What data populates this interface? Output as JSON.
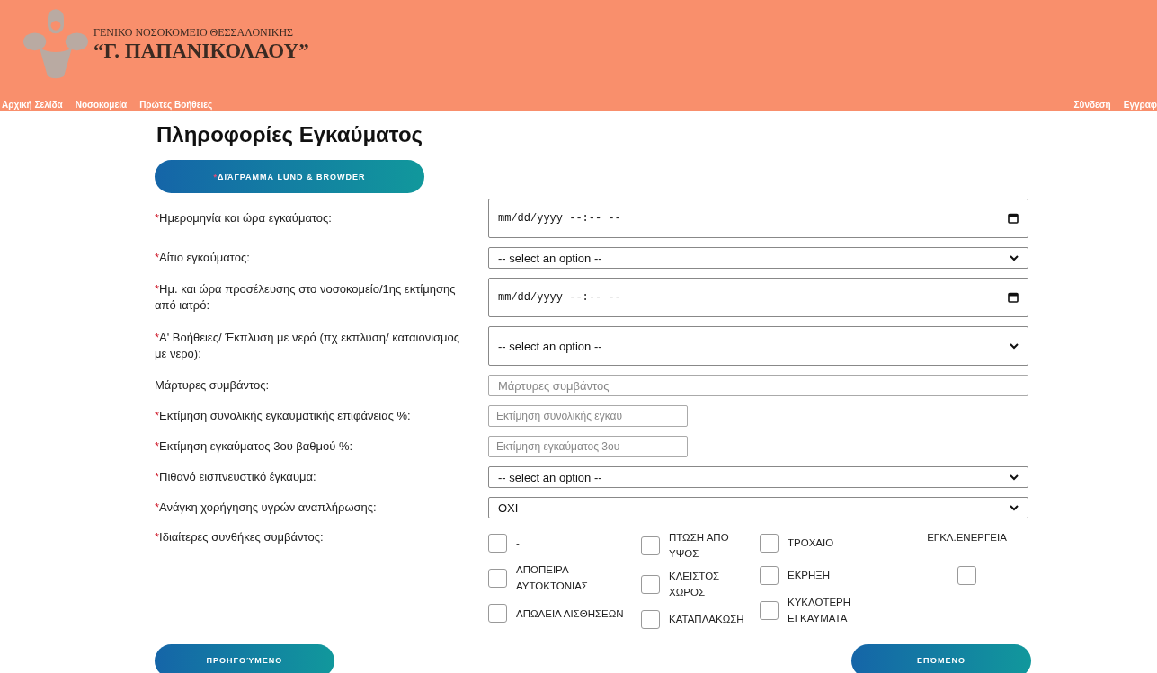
{
  "header": {
    "subtitle": "ΓΕΝΙΚΟ ΝΟΣΟΚΟΜΕΙΟ ΘΕΣΣΑΛΟΝΙΚΗΣ",
    "title": "“Γ. ΠΑΠΑΝΙΚΟΛΑΟΥ”"
  },
  "nav_left": [
    "Αρχική Σελίδα",
    "Νοσοκομεία",
    "Πρώτες Βοήθειες"
  ],
  "nav_right": [
    "Σύνδεση",
    "Εγγραφ"
  ],
  "page_title": "Πληροφορίες Εγκαύματος",
  "diagram_button": {
    "mark": "*",
    "label": "ΔΙΆΓΡΑΜΜΑ LUND & BROWDER"
  },
  "fields": [
    {
      "label": "Ημερομηνία και ώρα εγκαύματος:",
      "required": true,
      "kind": "datetime",
      "value": "mm/dd/yyyy --:-- --"
    },
    {
      "label": "Αίτιο εγκαύματος:",
      "required": true,
      "kind": "select",
      "value": "-- select an option --"
    },
    {
      "label": "Ημ. και ώρα προσέλευσης στο νοσοκομείο/1ης εκτίμησης από ιατρό:",
      "required": true,
      "kind": "datetime",
      "value": "mm/dd/yyyy --:-- --"
    },
    {
      "label": "Α' Βοήθειες/ Έκπλυση με νερό (πχ εκπλυση/ καταιονισμος με νερο):",
      "required": true,
      "kind": "select",
      "value": "-- select an option --"
    },
    {
      "label": "Μάρτυρες συμβάντος:",
      "required": false,
      "kind": "text",
      "placeholder": "Μάρτυρες συμβάντος"
    },
    {
      "label": "Εκτίμηση συνολικής εγκαυματικής επιφάνειας %:",
      "required": true,
      "kind": "short-text",
      "placeholder": "Εκτίμηση συνολικής εγκαυ"
    },
    {
      "label": "Εκτίμηση εγκαύματος 3ου βαθμού %:",
      "required": true,
      "kind": "short-text",
      "placeholder": "Εκτίμηση εγκαύματος 3ου"
    },
    {
      "label": "Πιθανό εισπνευστικό έγκαυμα:",
      "required": true,
      "kind": "select",
      "value": "-- select an option --"
    },
    {
      "label": "Ανάγκη χορήγησης υγρών αναπλήρωσης:",
      "required": true,
      "kind": "select",
      "value": "ΟΧΙ"
    }
  ],
  "conditions": {
    "label": "Ιδιαίτερες συνθήκες συμβάντος:",
    "required": true,
    "columns": [
      [
        {
          "kind": "checkbox",
          "label": "-",
          "checked": false
        },
        {
          "kind": "checkbox",
          "label": "ΑΠΟΠΕΙΡΑ ΑΥΤΟΚΤΟΝΙΑΣ",
          "checked": false
        },
        {
          "kind": "checkbox",
          "label": "ΑΠΩΛΕΙΑ ΑΙΣΘΗΣΕΩΝ",
          "checked": false
        }
      ],
      [
        {
          "kind": "checkbox",
          "label": "ΠΤΩΣΗ ΑΠΟ ΥΨΟΣ",
          "checked": false
        },
        {
          "kind": "checkbox",
          "label": "ΚΛΕΙΣΤΟΣ ΧΩΡΟΣ",
          "checked": false
        },
        {
          "kind": "checkbox",
          "label": "ΚΑΤΑΠΛΑΚΩΣΗ",
          "checked": false
        }
      ],
      [
        {
          "kind": "checkbox",
          "label": "ΤΡΟΧΑΙΟ",
          "checked": false
        },
        {
          "kind": "checkbox",
          "label": "ΕΚΡΗΞΗ",
          "checked": false
        },
        {
          "kind": "checkbox",
          "label": "ΚΥΚΛΟΤΕΡΗ ΕΓΚΑΥΜΑΤΑ",
          "checked": false
        }
      ],
      [
        {
          "kind": "text",
          "label": "ΕΓΚΛ.ΕΝΕΡΓΕΙΑ"
        },
        {
          "kind": "checkbox",
          "checked": false
        }
      ]
    ]
  },
  "buttons": {
    "previous": "ΠΡΟΗΓΟΎΜΕΝΟ",
    "next": "ΕΠΌΜΕΝΟ"
  }
}
